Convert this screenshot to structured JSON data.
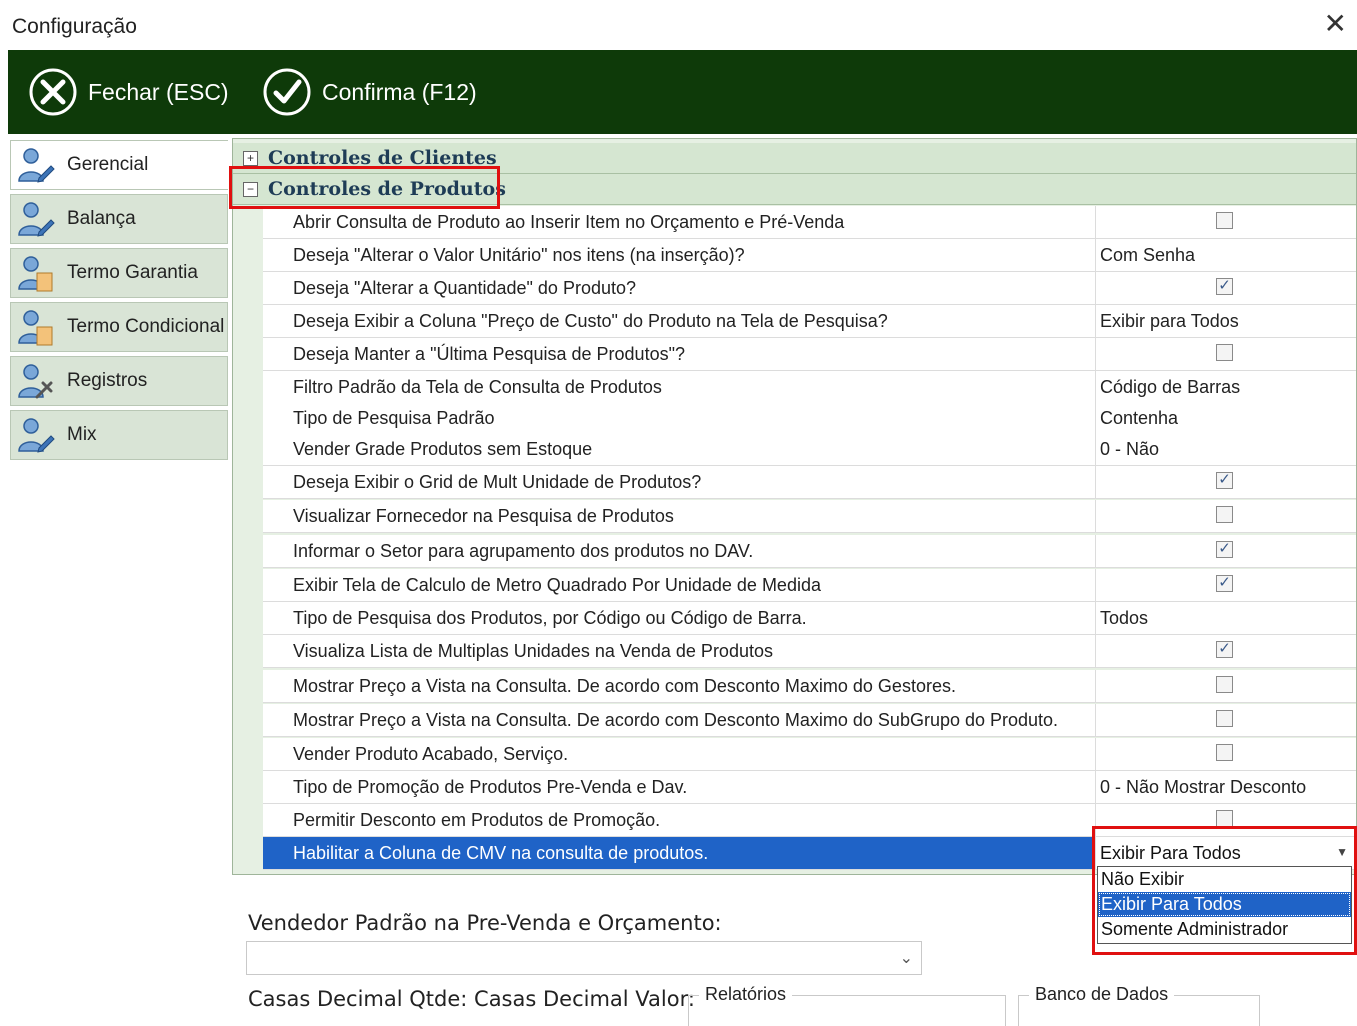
{
  "window": {
    "title": "Configuração",
    "close_glyph": "✕"
  },
  "toolbar": {
    "close_label": "Fechar (ESC)",
    "confirm_label": "Confirma (F12)",
    "close_icon": "x-circle-icon",
    "confirm_icon": "check-circle-icon"
  },
  "sidebar": {
    "items": [
      {
        "label": "Gerencial",
        "icon": "user-edit-icon",
        "active": true
      },
      {
        "label": "Balança",
        "icon": "user-edit-icon"
      },
      {
        "label": "Termo Garantia",
        "icon": "user-document-icon"
      },
      {
        "label": "Termo Condicional",
        "icon": "user-document-icon"
      },
      {
        "label": "Registros",
        "icon": "user-tools-icon"
      },
      {
        "label": "Mix",
        "icon": "user-edit-icon"
      }
    ]
  },
  "groups": {
    "clientes": {
      "label": "Controles de Clientes",
      "expander": "+"
    },
    "produtos": {
      "label": "Controles de Produtos",
      "expander": "−"
    }
  },
  "rows": [
    {
      "label": "Abrir Consulta de Produto ao Inserir Item no Orçamento e Pré-Venda",
      "type": "check",
      "checked": false
    },
    {
      "label": "Deseja \"Alterar o Valor Unitário\" nos itens (na inserção)?",
      "type": "text",
      "value": "Com Senha"
    },
    {
      "label": "Deseja \"Alterar a Quantidade\" do Produto?",
      "type": "check",
      "checked": true
    },
    {
      "label": "Deseja Exibir a Coluna \"Preço de Custo\" do Produto na Tela de Pesquisa?",
      "type": "text",
      "value": "Exibir para Todos"
    },
    {
      "label": "Deseja Manter a \"Última Pesquisa de Produtos\"?",
      "type": "check",
      "checked": false
    },
    {
      "label": "Filtro Padrão da Tela de Consulta de Produtos",
      "type": "text",
      "value": "Código de Barras"
    },
    {
      "label": "Tipo de Pesquisa Padrão",
      "type": "text",
      "value": "Contenha"
    },
    {
      "label": "Vender Grade Produtos sem Estoque",
      "type": "text",
      "value": "0 - Não"
    },
    {
      "label": "Deseja Exibir o Grid de Mult Unidade de Produtos?",
      "type": "check",
      "checked": true
    },
    {
      "label": "Visualizar Fornecedor na Pesquisa de Produtos",
      "type": "check",
      "checked": false
    },
    {
      "label": "Informar o Setor para agrupamento dos produtos no DAV.",
      "type": "check",
      "checked": true
    },
    {
      "label": "Exibir Tela de Calculo de Metro Quadrado Por Unidade de Medida",
      "type": "check",
      "checked": true
    },
    {
      "label": "Tipo de Pesquisa dos Produtos, por Código ou Código de Barra.",
      "type": "text",
      "value": "Todos"
    },
    {
      "label": "Visualiza Lista de Multiplas Unidades na Venda de Produtos",
      "type": "check",
      "checked": true
    },
    {
      "label": "Mostrar Preço a Vista na Consulta. De acordo com Desconto Maximo do Gestores.",
      "type": "check",
      "checked": false
    },
    {
      "label": "Mostrar Preço a Vista na Consulta. De acordo com Desconto Maximo do SubGrupo do Produto.",
      "type": "check",
      "checked": false
    },
    {
      "label": "Vender Produto Acabado, Serviço.",
      "type": "check",
      "checked": false
    },
    {
      "label": "Tipo de Promoção de Produtos Pre-Venda e Dav.",
      "type": "text",
      "value": "0 - Não Mostrar Desconto"
    },
    {
      "label": "Permitir Desconto em Produtos de Promoção.",
      "type": "check",
      "checked": false
    },
    {
      "label": "Habilitar a Coluna de CMV na consulta de produtos.",
      "type": "combo",
      "value": "Exibir Para Todos",
      "selected": true
    }
  ],
  "dropdown": {
    "options": [
      "Não Exibir",
      "Exibir Para Todos",
      "Somente Administrador"
    ],
    "selected": "Exibir Para Todos",
    "arrow": "▼"
  },
  "bottom": {
    "vendedor_label": "Vendedor Padrão na Pre-Venda e Orçamento:",
    "vendedor_value": "",
    "chevron": "⌄",
    "casas_label": "Casas Decimal Qtde:  Casas Decimal Valor:",
    "relatorios_label": "Relatórios",
    "banco_label": "Banco de Dados"
  }
}
